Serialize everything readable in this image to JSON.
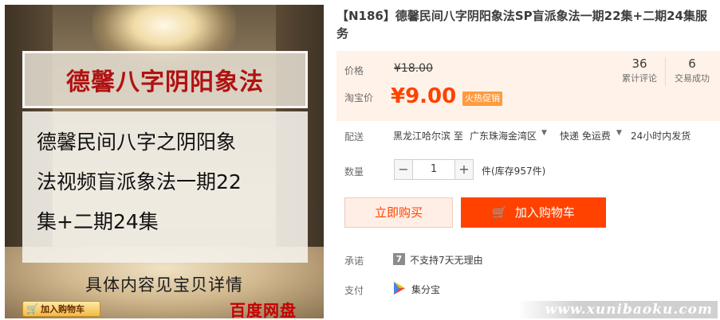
{
  "image": {
    "banner_title": "德馨八字阴阳象法",
    "desc_lines": [
      "德馨民间八字之阴阳象",
      "法视频盲派象法一期22",
      "集+二期24集"
    ],
    "sub_note": "具体内容见宝贝详情",
    "cart_badge": "加入购物车",
    "pan_label": "百度网盘"
  },
  "product": {
    "title": "【N186】德馨民间八字阴阳象法SP盲派象法一期22集+二期24集服务"
  },
  "price": {
    "price_label": "价格",
    "original_price": "¥18.00",
    "taobao_label": "淘宝价",
    "sale_price": "¥9.00",
    "promo_badge": "火热促销",
    "accent_color": "#ff4200"
  },
  "stats": [
    {
      "value": "36",
      "label": "累计评论"
    },
    {
      "value": "6",
      "label": "交易成功"
    }
  ],
  "shipping": {
    "label": "配送",
    "from": "黑龙江哈尔滨 至",
    "to": "广东珠海金湾区",
    "method": "快递 免运费",
    "eta": "24小时内发货"
  },
  "quantity": {
    "label": "数量",
    "minus": "−",
    "value": "1",
    "plus": "+",
    "stock": "件(库存957件)"
  },
  "buttons": {
    "buy_now": "立即购买",
    "add_to_cart": "加入购物车"
  },
  "promise": {
    "label": "承诺",
    "icon_text": "7",
    "text": "不支持7天无理由"
  },
  "payment": {
    "label": "支付",
    "text": "集分宝"
  },
  "site_watermark": "www.xunibaoku.com"
}
